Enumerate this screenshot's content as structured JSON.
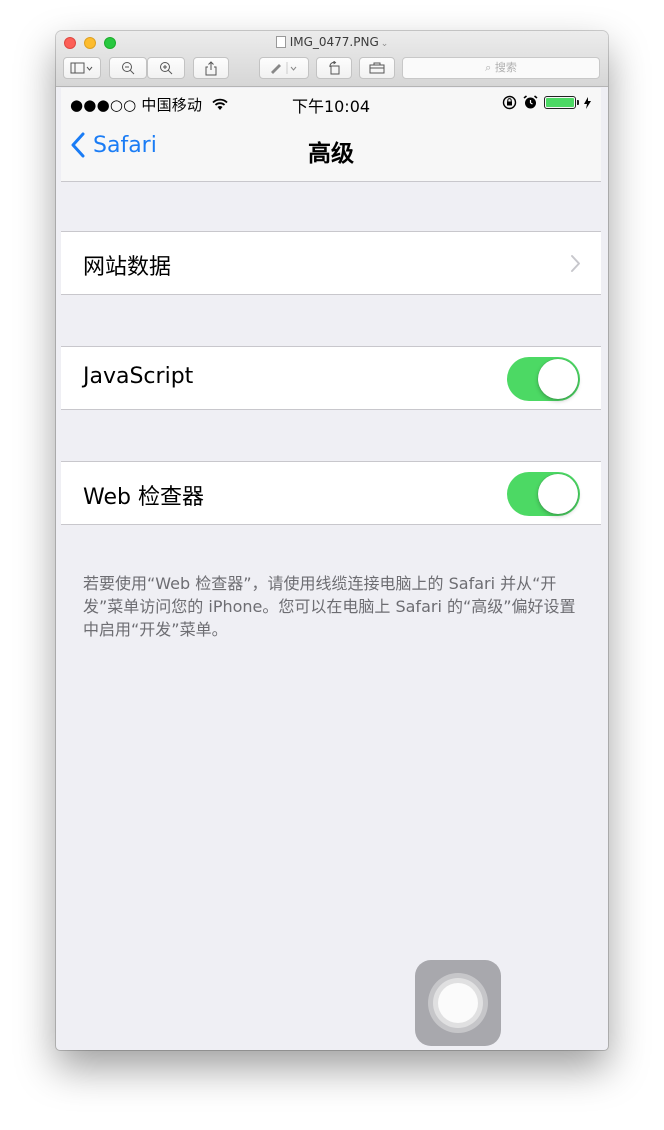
{
  "window": {
    "file_name": "IMG_0477.PNG",
    "search_placeholder": "搜索"
  },
  "status_bar": {
    "carrier": "●●●○○ 中国移动",
    "time": "下午10:04"
  },
  "nav": {
    "back_label": "Safari",
    "title": "高级"
  },
  "cells": {
    "website_data": "网站数据",
    "javascript": "JavaScript",
    "javascript_on": true,
    "web_inspector": "Web 检查器",
    "web_inspector_on": true
  },
  "footer_note": "若要使用“Web 检查器”，请使用线缆连接电脑上的 Safari 并从“开发”菜单访问您的 iPhone。您可以在电脑上 Safari 的“高级”偏好设置中启用“开发”菜单。",
  "colors": {
    "ios_blue": "#1a7cf5",
    "toggle_green": "#4cd964",
    "grouped_background": "#efeff4"
  }
}
